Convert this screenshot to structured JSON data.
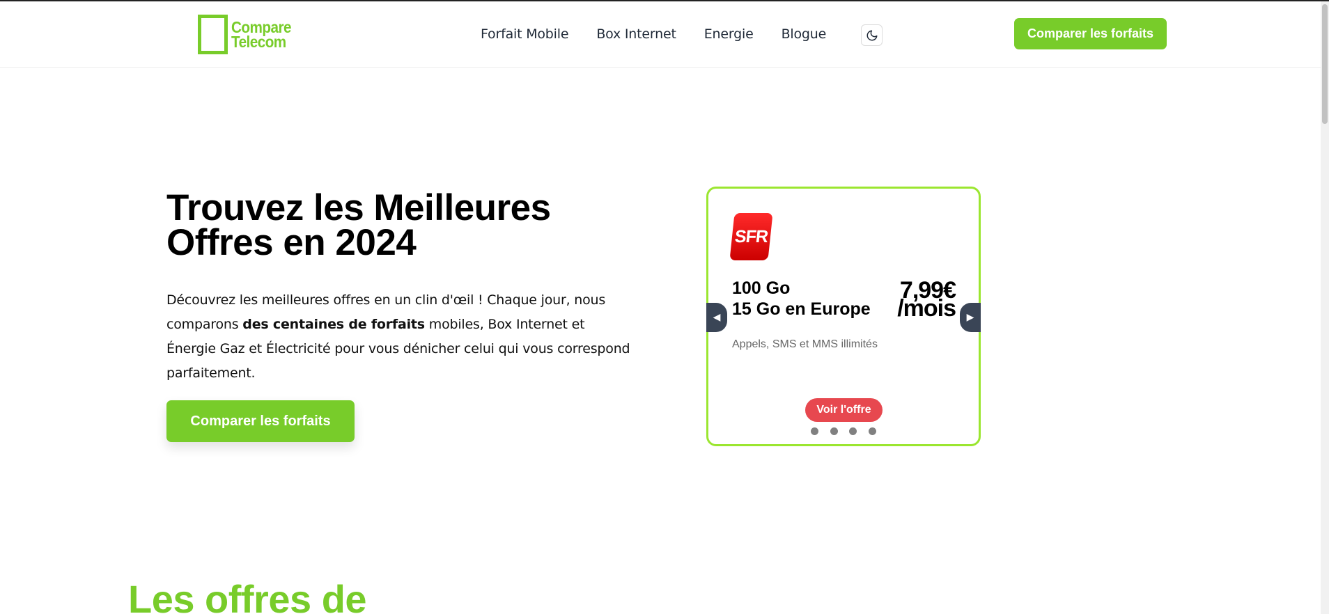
{
  "brand": {
    "line1": "Compare",
    "line2": "Telecom",
    "accent_color": "#78cc2a"
  },
  "nav": {
    "items": [
      {
        "label": "Forfait Mobile"
      },
      {
        "label": "Box Internet"
      },
      {
        "label": "Energie"
      },
      {
        "label": "Blogue"
      }
    ],
    "theme_toggle_icon": "moon-icon"
  },
  "header": {
    "cta_label": "Comparer les forfaits"
  },
  "hero": {
    "title": "Trouvez les Meilleures Offres en 2024",
    "desc_part1": "Découvrez les meilleures offres en un clin d'œil ! Chaque jour, nous comparons ",
    "desc_bold": "des centaines de forfaits",
    "desc_part2": " mobiles, Box Internet et Énergie Gaz et Électricité pour vous dénicher celui qui vous correspond parfaitement.",
    "cta_label": "Comparer les forfaits"
  },
  "offer_card": {
    "operator_logo_text": "SFR",
    "data_line1": "100 Go",
    "data_line2": "15 Go en Europe",
    "price": "7,99€",
    "price_period": "/mois",
    "features": "Appels, SMS et MMS illimités",
    "cta_label": "Voir l'offre",
    "prev_arrow": "◀",
    "next_arrow": "▶",
    "slide_count": 4,
    "border_color": "#9be630",
    "cta_color": "#e7484f"
  },
  "section": {
    "title": "Les offres de"
  }
}
